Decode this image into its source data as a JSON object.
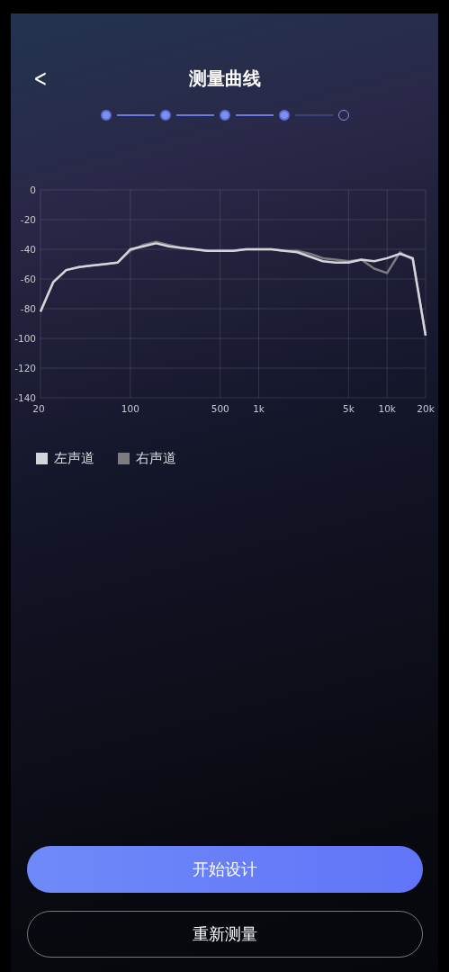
{
  "header": {
    "back": "<",
    "title": "测量曲线"
  },
  "steps": [
    {
      "done": true
    },
    {
      "done": true
    },
    {
      "done": true
    },
    {
      "done": true
    },
    {
      "done": false
    }
  ],
  "chart_data": {
    "type": "line",
    "categories": [
      "20",
      null,
      null,
      null,
      null,
      null,
      null,
      "100",
      null,
      null,
      null,
      null,
      null,
      null,
      "500",
      null,
      null,
      "1k",
      null,
      null,
      null,
      null,
      null,
      null,
      "5k",
      null,
      null,
      "10k",
      null,
      null,
      "20k"
    ],
    "series": [
      {
        "name": "左声道",
        "color": "#d4d4dc",
        "values": [
          -82,
          -62,
          -54,
          -52,
          -51,
          -50,
          -49,
          -40,
          -38,
          -36,
          -38,
          -39,
          -40,
          -41,
          -41,
          -41,
          -40,
          -40,
          -40,
          -41,
          -42,
          -45,
          -48,
          -49,
          -49,
          -47,
          -48,
          -46,
          -43,
          -46,
          -98
        ]
      },
      {
        "name": "右声道",
        "color": "#7c7c80",
        "values": [
          -82,
          -62,
          -54,
          -52,
          -51,
          -50,
          -49,
          -41,
          -37,
          -35,
          -37,
          -39,
          -40,
          -41,
          -41,
          -41,
          -40,
          -40,
          -40,
          -41,
          -41,
          -43,
          -46,
          -47,
          -48,
          -47,
          -53,
          -56,
          -42,
          -47,
          -98
        ]
      }
    ],
    "grid": true,
    "ylim": [
      -140,
      0
    ],
    "yticks": [
      0,
      -20,
      -40,
      -60,
      -80,
      -100,
      -120,
      -140
    ]
  },
  "buttons": [
    {
      "kind": "primary",
      "label": "开始设计"
    },
    {
      "kind": "outline",
      "label": "重新测量"
    }
  ]
}
